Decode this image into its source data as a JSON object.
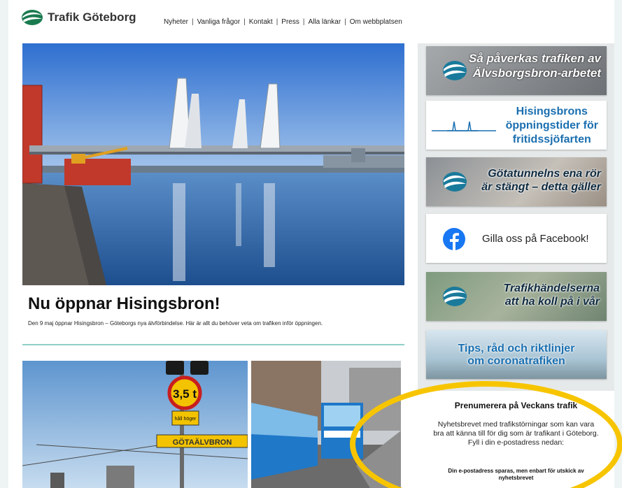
{
  "header": {
    "site_title": "Trafik Göteborg",
    "nav": [
      "Nyheter",
      "Vanliga frågor",
      "Kontakt",
      "Press",
      "Alla länkar",
      "Om webbplatsen"
    ],
    "nav_separator": "|"
  },
  "main": {
    "headline": "Nu öppnar Hisingsbron!",
    "subtext": "Den 9 maj öppnar Hisingsbron – Göteborgs nya älvförbindelse. Här är allt du behöver veta om trafiken inför öppningen.",
    "sign_weight": "3,5 t",
    "sign_lane": "håll höger",
    "sign_bridge": "GÖTAÄLVBRON"
  },
  "sidebar": {
    "tiles": [
      {
        "line1": "Så påverkas trafiken av",
        "line2": "Älvsborgsbron-arbetet"
      },
      {
        "line1": "Hisingsbrons",
        "line2": "öppningstider för",
        "line3": "fritidssjöfarten"
      },
      {
        "line1": "Götatunnelns ena rör",
        "line2": "är stängt – detta gäller"
      },
      {
        "line1": "Gilla oss på Facebook!"
      },
      {
        "line1": "Trafikhändelserna",
        "line2": "att ha koll på i vår"
      },
      {
        "line1": "Tips, råd och riktlinjer",
        "line2": "om coronatrafiken"
      }
    ],
    "newsletter": {
      "title": "Prenumerera på Veckans trafik",
      "body": "Nyhetsbrevet med trafikstörningar som kan vara bra att känna till för dig som är trafikant i Göteborg. Fyll i din e-postadress nedan:",
      "note": "Din e-postadress sparas, men enbart för utskick av nyhetsbrevet"
    }
  },
  "colors": {
    "accent": "#8fd0c6",
    "brand_blue": "#1a6fb0",
    "highlight": "#f7c500",
    "facebook": "#1877f2"
  },
  "icons": [
    "trafik-logo-icon",
    "swirl-logo-icon",
    "bridge-line-icon",
    "facebook-icon"
  ]
}
